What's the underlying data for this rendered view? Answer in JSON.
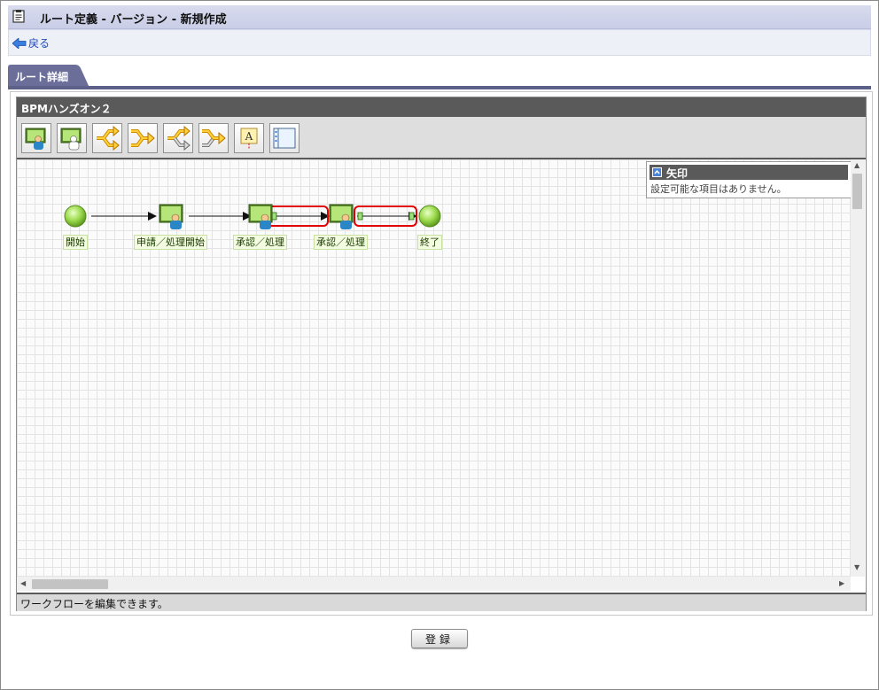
{
  "window": {
    "title": "ルート定義 - バージョン - 新規作成",
    "back_label": "戻る"
  },
  "tab": {
    "label": "ルート詳細"
  },
  "editor": {
    "title": "BPMハンズオン２",
    "status_text": "ワークフローを編集できます。",
    "toolbar": [
      {
        "name": "user-node-tool-icon",
        "tooltip": "処理"
      },
      {
        "name": "user-node-alt-tool-icon",
        "tooltip": "処理"
      },
      {
        "name": "branch-tool-icon",
        "tooltip": "分岐"
      },
      {
        "name": "join-tool-icon",
        "tooltip": "結合"
      },
      {
        "name": "branch-gray-tool-icon",
        "tooltip": "分岐"
      },
      {
        "name": "join-gray-tool-icon",
        "tooltip": "結合"
      },
      {
        "name": "text-annotation-tool-icon",
        "tooltip": "A"
      },
      {
        "name": "form-tool-icon",
        "tooltip": "フォーム"
      }
    ],
    "properties": {
      "title": "矢印",
      "message": "設定可能な項目はありません。"
    },
    "nodes": [
      {
        "id": "start",
        "type": "start",
        "label": "開始"
      },
      {
        "id": "apply",
        "type": "user",
        "label": "申請／処理開始"
      },
      {
        "id": "approve1",
        "type": "user",
        "label": "承認／処理"
      },
      {
        "id": "approve2",
        "type": "user",
        "label": "承認／処理"
      },
      {
        "id": "end",
        "type": "end",
        "label": "終了"
      }
    ],
    "edges": [
      {
        "from": "start",
        "to": "apply",
        "selected": false
      },
      {
        "from": "apply",
        "to": "approve1",
        "selected": false
      },
      {
        "from": "approve1",
        "to": "approve2",
        "selected": true
      },
      {
        "from": "approve2",
        "to": "end",
        "selected": true
      }
    ],
    "colors": {
      "selection": "#e00000",
      "node_fill": "#8fd14f",
      "toolbar_arrow": "#f2b400"
    }
  },
  "footer": {
    "register_label": "登録"
  }
}
